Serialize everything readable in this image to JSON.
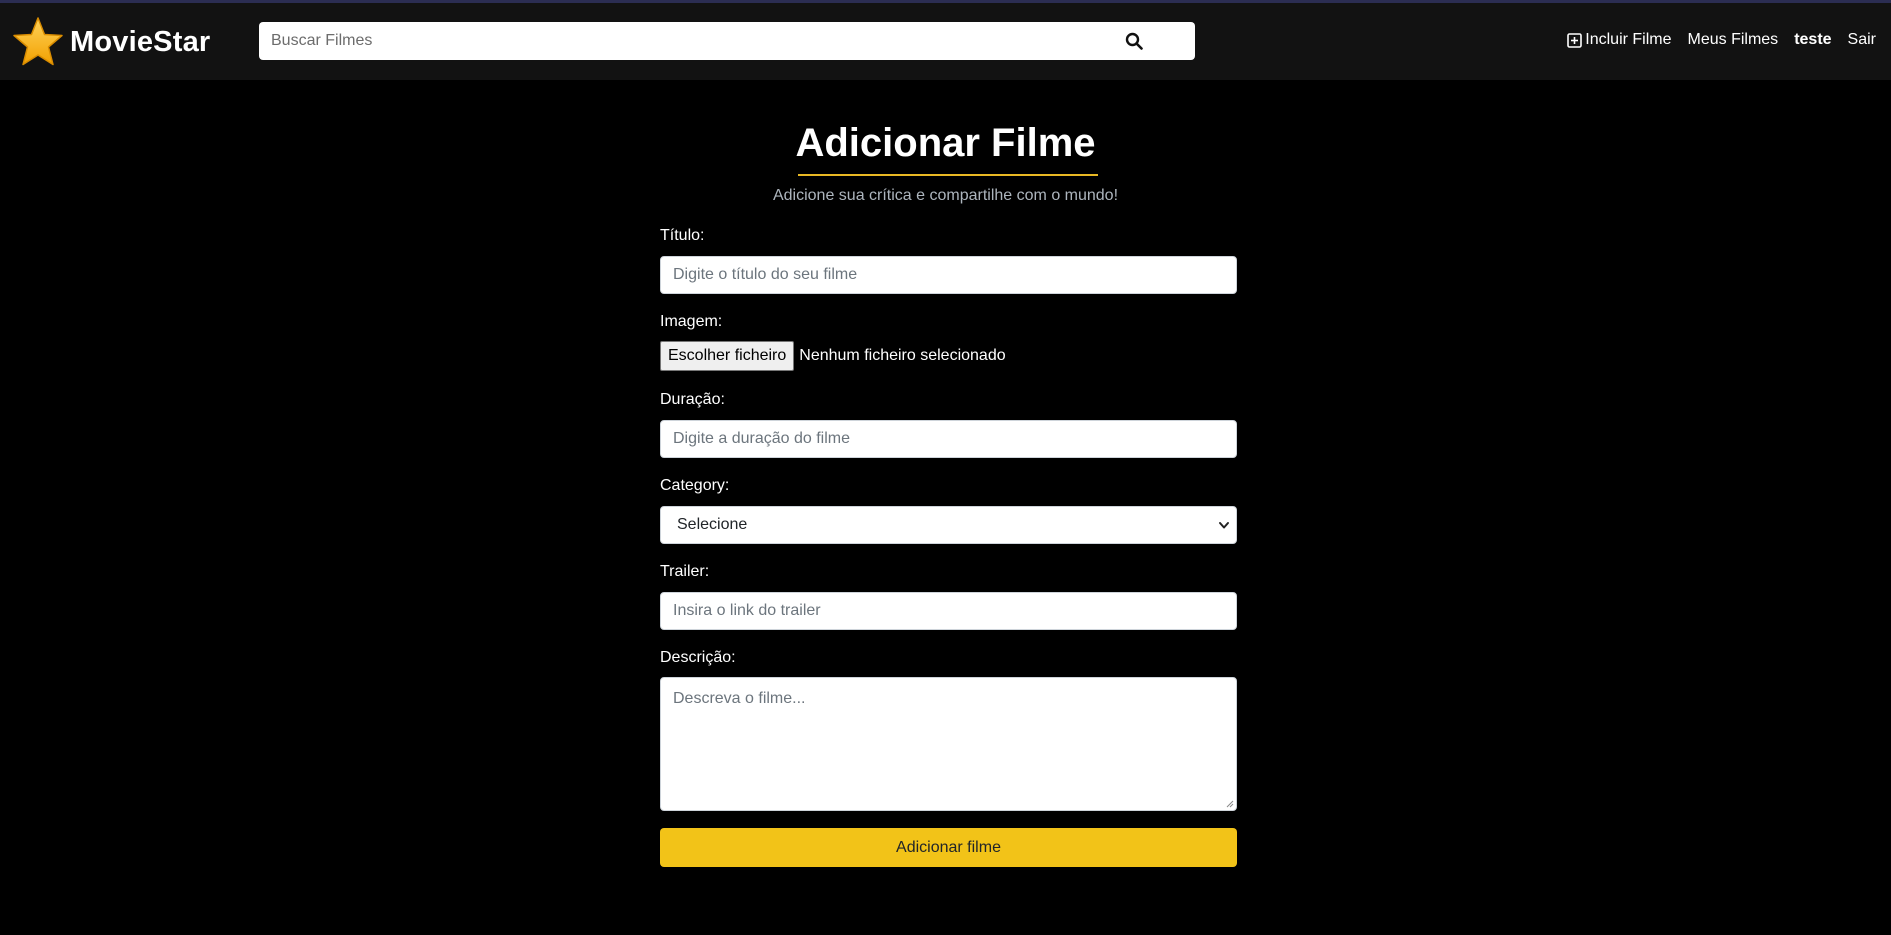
{
  "header": {
    "brand": "MovieStar",
    "search_placeholder": "Buscar Filmes",
    "nav": {
      "add_movie": "Incluir Filme",
      "my_movies": "Meus Filmes",
      "user": "teste",
      "logout": "Sair"
    }
  },
  "main": {
    "title": "Adicionar Filme",
    "subtitle": "Adicione sua crítica e compartilhe com o mundo!"
  },
  "form": {
    "title_label": "Título:",
    "title_placeholder": "Digite o título do seu filme",
    "image_label": "Imagem:",
    "file_button": "Escolher ficheiro",
    "file_status": "Nenhum ficheiro selecionado",
    "duration_label": "Duração:",
    "duration_placeholder": "Digite a duração do filme",
    "category_label": "Category:",
    "category_selected": "Selecione",
    "trailer_label": "Trailer:",
    "trailer_placeholder": "Insira o link do trailer",
    "description_label": "Descrição:",
    "description_placeholder": "Descreva o filme...",
    "submit_label": "Adicionar filme"
  },
  "colors": {
    "accent": "#f2c318",
    "header_bg": "#121212",
    "page_bg": "#000000"
  },
  "icons": {
    "logo": "star-icon",
    "search": "search-icon",
    "add": "plus-square-icon",
    "select": "chevron-down-icon"
  }
}
